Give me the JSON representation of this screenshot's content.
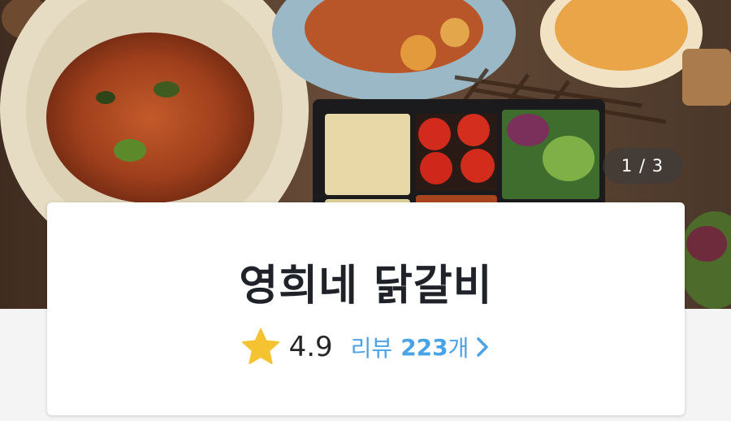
{
  "hero": {
    "image_description": "food-photo",
    "pager_text": "1 / 3"
  },
  "restaurant": {
    "name": "영희네 닭갈비",
    "rating": "4.9",
    "review_prefix": "리뷰",
    "review_count": "223",
    "review_suffix": "개"
  },
  "colors": {
    "accent": "#4aa3e6",
    "star": "#f5c231",
    "title": "#1f2329"
  },
  "icons": {
    "rating": "star-icon",
    "review_link": "chevron-right-icon"
  }
}
